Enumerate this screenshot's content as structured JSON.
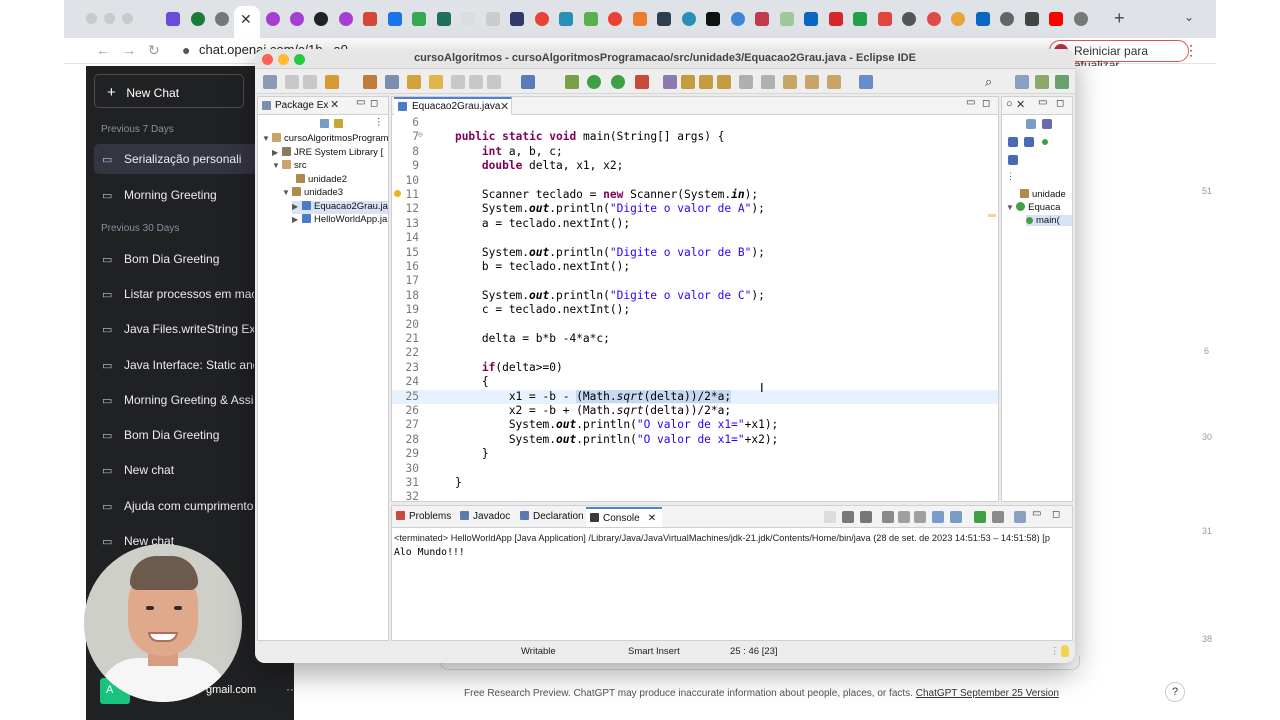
{
  "browser": {
    "url": "chat.openai.com/c/1b...a0-...",
    "update_button": "Reiniciar para atualizar"
  },
  "chatgpt": {
    "new_chat": "New Chat",
    "groups": [
      {
        "header": "Previous 7 Days",
        "items": [
          "Serialização personali",
          "Morning Greeting"
        ]
      },
      {
        "header": "Previous 30 Days",
        "items": [
          "Bom Dia Greeting",
          "Listar processos em macO",
          "Java Files.writeString Exam",
          "Java Interface: Static and D",
          "Morning Greeting & Assist",
          "Bom Dia Greeting",
          "New chat",
          "Ajuda com cumprimentos.",
          "New chat"
        ]
      }
    ],
    "user_email": "gmail.com",
    "user_initials": "A",
    "footer_text": "Free Research Preview. ChatGPT may produce inaccurate information about people, places, or facts.",
    "footer_link": "ChatGPT September 25 Version",
    "help": "?"
  },
  "eclipse": {
    "title": "cursoAlgoritmos - cursoAlgoritmosProgramacao/src/unidade3/Equacao2Grau.java - Eclipse IDE",
    "package_explorer": {
      "tab_label": "Package Ex",
      "tree": [
        "cursoAlgoritmosProgram",
        "JRE System Library [",
        "src",
        "unidade2",
        "unidade3",
        "Equacao2Grau.ja",
        "HelloWorldApp.ja"
      ]
    },
    "editor": {
      "tab_label": "Equacao2Grau.java",
      "code_lines": [
        {
          "n": "6",
          "t": ""
        },
        {
          "n": "7",
          "t": "    public static void main(String[] args) {"
        },
        {
          "n": "8",
          "t": "        int a, b, c;"
        },
        {
          "n": "9",
          "t": "        double delta, x1, x2;"
        },
        {
          "n": "10",
          "t": ""
        },
        {
          "n": "11",
          "t": "        Scanner teclado = new Scanner(System.in);"
        },
        {
          "n": "12",
          "t": "        System.out.println(\"Digite o valor de A\");"
        },
        {
          "n": "13",
          "t": "        a = teclado.nextInt();"
        },
        {
          "n": "14",
          "t": ""
        },
        {
          "n": "15",
          "t": "        System.out.println(\"Digite o valor de B\");"
        },
        {
          "n": "16",
          "t": "        b = teclado.nextInt();"
        },
        {
          "n": "17",
          "t": ""
        },
        {
          "n": "18",
          "t": "        System.out.println(\"Digite o valor de C\");"
        },
        {
          "n": "19",
          "t": "        c = teclado.nextInt();"
        },
        {
          "n": "20",
          "t": ""
        },
        {
          "n": "21",
          "t": "        delta = b*b -4*a*c;"
        },
        {
          "n": "22",
          "t": ""
        },
        {
          "n": "23",
          "t": "        if(delta>=0)"
        },
        {
          "n": "24",
          "t": "        {"
        },
        {
          "n": "25",
          "t": "            x1 = -b - (Math.sqrt(delta))/2*a;"
        },
        {
          "n": "26",
          "t": "            x2 = -b + (Math.sqrt(delta))/2*a;"
        },
        {
          "n": "27",
          "t": "            System.out.println(\"O valor de x1=\"+x1);"
        },
        {
          "n": "28",
          "t": "            System.out.println(\"O valor de x1=\"+x2);"
        },
        {
          "n": "29",
          "t": "        }"
        },
        {
          "n": "30",
          "t": ""
        },
        {
          "n": "31",
          "t": "    }"
        },
        {
          "n": "32",
          "t": ""
        }
      ]
    },
    "outline": {
      "items": [
        "unidade",
        "Equaca",
        "main("
      ]
    },
    "console": {
      "tabs": [
        "Problems",
        "Javadoc",
        "Declaration",
        "Console"
      ],
      "terminated": "<terminated> HelloWorldApp [Java Application] /Library/Java/JavaVirtualMachines/jdk-21.jdk/Contents/Home/bin/java  (28 de set. de 2023 14:51:53 – 14:51:58) [p",
      "output": "Alo Mundo!!!"
    },
    "status": {
      "writable": "Writable",
      "insert_mode": "Smart Insert",
      "position": "25 : 46 [23]"
    }
  },
  "colors": {
    "keyword": "#7f0055",
    "string": "#2a00ff",
    "sidebar_bg": "#202123",
    "selection": "#c7d8f3"
  },
  "edge_numbers": [
    "51",
    "6",
    "30",
    "31",
    "38"
  ]
}
